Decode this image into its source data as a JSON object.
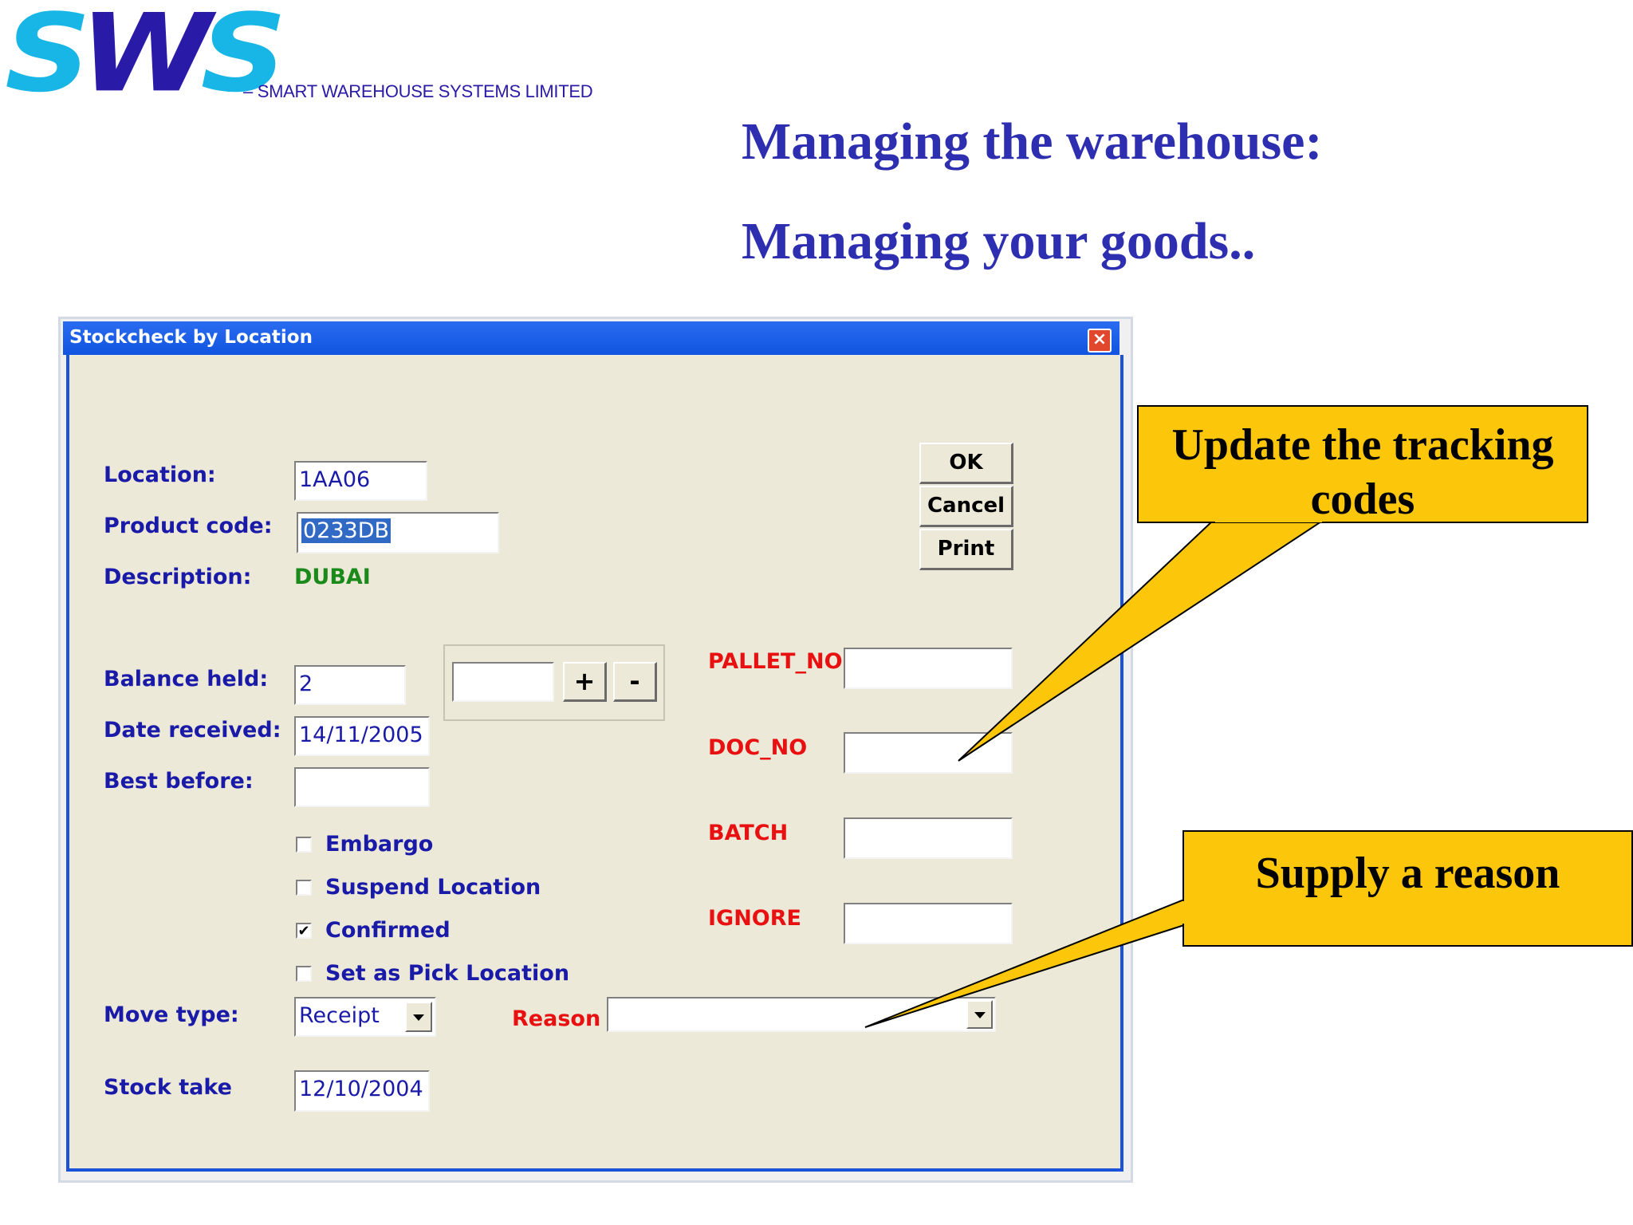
{
  "brand": {
    "logo_s1": "S",
    "logo_w": "W",
    "logo_s2": "S",
    "tagline": "– SMART WAREHOUSE SYSTEMS LIMITED",
    "colors": {
      "cyan": "#18b6e6",
      "navy": "#2a1aa8"
    }
  },
  "headlines": {
    "line1": "Managing the warehouse:",
    "line2": "Managing your goods.."
  },
  "dialog": {
    "title": "Stockcheck by Location",
    "close_glyph": "×",
    "labels": {
      "location": "Location:",
      "product_code": "Product code:",
      "description": "Description:",
      "balance_held": "Balance held:",
      "date_received": "Date received:",
      "best_before": "Best before:",
      "move_type": "Move type:",
      "stock_take": "Stock take",
      "reason": "Reason"
    },
    "values": {
      "location": "1AA06",
      "product_code": "0233DB",
      "description": "DUBAI",
      "balance_held": "2",
      "adjust_qty": "",
      "date_received": "14/11/2005",
      "best_before": "",
      "move_type": "Receipt",
      "reason": "",
      "stock_take": "12/10/2004"
    },
    "buttons": {
      "ok": "OK",
      "cancel": "Cancel",
      "print": "Print",
      "plus": "+",
      "minus": "-"
    },
    "checkboxes": [
      {
        "label": "Embargo",
        "checked": false
      },
      {
        "label": "Suspend Location",
        "checked": false
      },
      {
        "label": "Confirmed",
        "checked": true
      },
      {
        "label": "Set as Pick Location",
        "checked": false
      }
    ],
    "tracking": {
      "pallet_no": {
        "label": "PALLET_NO",
        "value": ""
      },
      "doc_no": {
        "label": "DOC_NO",
        "value": ""
      },
      "batch": {
        "label": "BATCH",
        "value": ""
      },
      "ignore": {
        "label": "IGNORE",
        "value": ""
      }
    }
  },
  "callouts": {
    "tracking": "Update the tracking codes",
    "reason": "Supply a reason"
  }
}
